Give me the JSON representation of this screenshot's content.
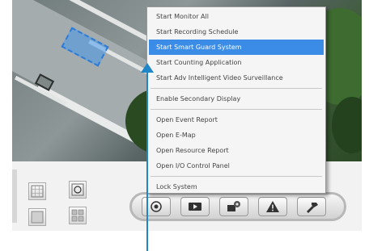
{
  "menu": {
    "items": [
      {
        "label": "Start Monitor All"
      },
      {
        "label": "Start Recording Schedule"
      },
      {
        "label": "Start Smart Guard System"
      },
      {
        "label": "Start Counting Application"
      },
      {
        "label": "Start Adv Intelligent Video Surveillance"
      },
      {
        "label": "Enable Secondary Display"
      },
      {
        "label": "Open Event Report"
      },
      {
        "label": "Open E-Map"
      },
      {
        "label": "Open Resource Report"
      },
      {
        "label": "Open I/O Control Panel"
      },
      {
        "label": "Lock System"
      }
    ],
    "selected_index": 2
  },
  "toolbar": {
    "buttons": [
      {
        "icon": "record-icon"
      },
      {
        "icon": "playback-icon"
      },
      {
        "icon": "camera-settings-icon"
      },
      {
        "icon": "alert-icon"
      },
      {
        "icon": "tools-icon"
      }
    ],
    "layout_buttons": [
      {
        "icon": "grid-layout-icon"
      },
      {
        "icon": "single-view-icon"
      },
      {
        "icon": "rotate-layout-icon"
      },
      {
        "icon": "quad-layout-icon"
      }
    ]
  },
  "colors": {
    "highlight": "#3b8ce6",
    "annotation_arrow": "#1f86c8",
    "target_overlay": "#2d7bd8"
  }
}
